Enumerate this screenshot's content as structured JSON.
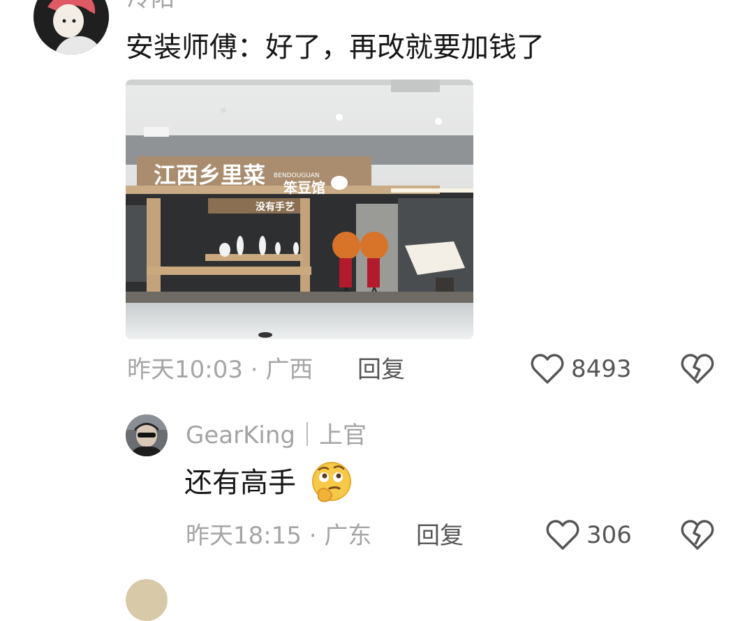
{
  "comments": [
    {
      "username": "冷阳",
      "text": "安装师傅：好了，再改就要加钱了",
      "meta": "昨天10:03 · 广西",
      "reply_label": "回复",
      "likes": "8493",
      "image": {
        "sign_main": "江西乡里菜",
        "sign_brand_en": "BENDOUGUAN",
        "sign_brand_cn": "笨豆馆",
        "sign_sub": "没有手艺"
      }
    },
    {
      "username": "GearKing｜上官",
      "text": "还有高手",
      "meta": "昨天18:15 · 广东",
      "reply_label": "回复",
      "likes": "306",
      "emoji": "thinking-face"
    }
  ],
  "colors": {
    "meta": "#a5a5a5",
    "text": "#161616",
    "icon": "#555555"
  }
}
